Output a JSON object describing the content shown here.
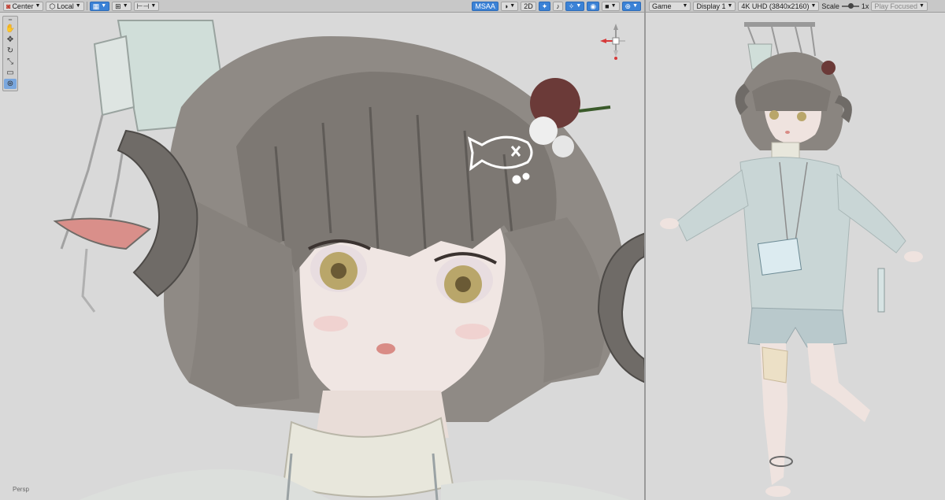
{
  "scene_toolbar": {
    "pivot_label": "Center",
    "space_label": "Local",
    "msaa_label": "MSAA",
    "mode_2d_label": "2D"
  },
  "game_toolbar": {
    "view_label": "Game",
    "display_label": "Display 1",
    "resolution_label": "4K UHD (3840x2160)",
    "scale_label": "Scale",
    "scale_value": "1x",
    "play_mode_label": "Play Focused"
  },
  "scene_view": {
    "corner_label": "Persp"
  },
  "icons": {
    "tools": [
      "hand-icon",
      "move-icon",
      "rotate-icon",
      "scale-icon",
      "rect-icon",
      "transform-icon"
    ]
  },
  "colors": {
    "accent": "#3b82d6",
    "viewport_bg": "#d9d9d9",
    "hair": "#8a8580",
    "skin": "#efe3df",
    "eye": "#b9a66a",
    "clothes": "#c9d6d6"
  }
}
